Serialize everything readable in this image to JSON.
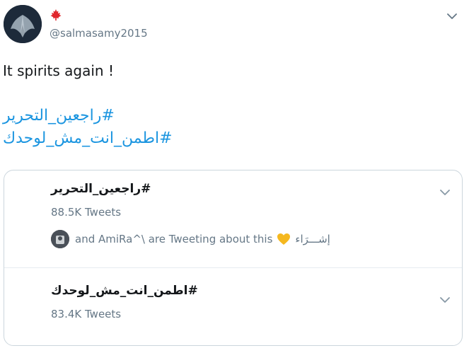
{
  "user": {
    "handle": "@salmasamy2015",
    "flag_icon": "maple-leaf-icon",
    "avatar_icon": "wings-icon"
  },
  "tweet": {
    "text": "It spirits again !",
    "hashtags": [
      "#راجعين_التحرير",
      "#اطمن_انت_مش_لوحدك"
    ]
  },
  "trends": [
    {
      "name": "#راجعين_التحرير",
      "count": "88.5K Tweets",
      "context": "and AmiRa^\\ are Tweeting about this",
      "context_extra": "إشـــرَاء"
    },
    {
      "name": "#اطمن_انت_مش_لوحدك",
      "count": "83.4K Tweets"
    }
  ],
  "colors": {
    "link": "#1b95e0",
    "secondary_text": "#657786",
    "border": "#ccd6dd",
    "flag_red": "#e0262c",
    "heart_yellow": "#f5b81f"
  }
}
